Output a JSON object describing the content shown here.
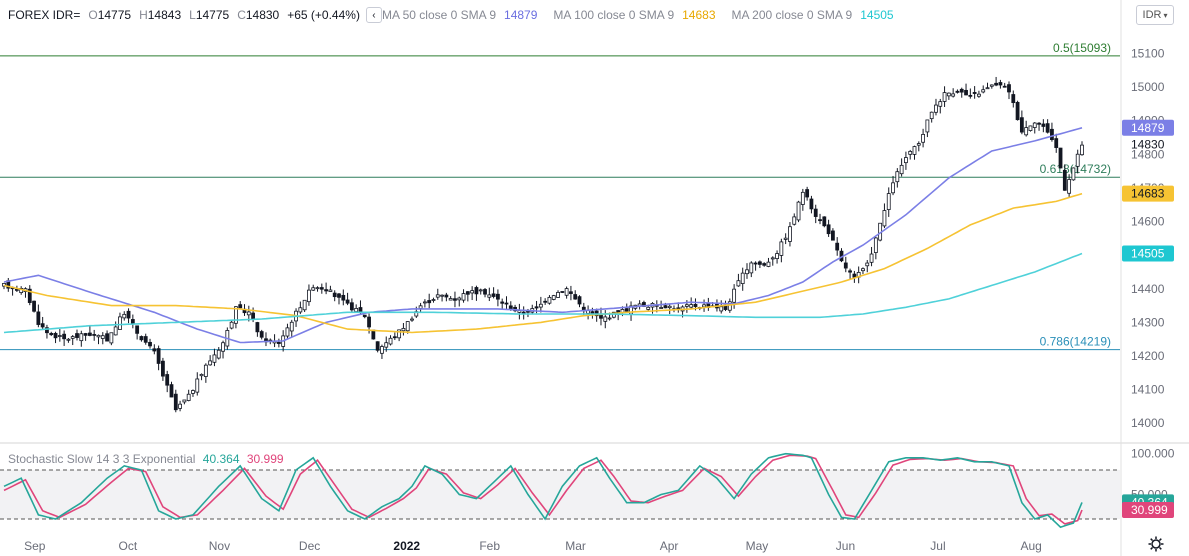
{
  "header": {
    "symbol": "FOREX IDR=",
    "o_label": "O",
    "o": "14775",
    "h_label": "H",
    "h": "14843",
    "l_label": "L",
    "l": "14775",
    "c_label": "C",
    "c": "14830",
    "change": "+65 (+0.44%)",
    "collapse_icon": "chevron-left-icon",
    "ma50_label": "MA 50 close 0 SMA 9",
    "ma50_value": "14879",
    "ma100_label": "MA 100 close 0 SMA 9",
    "ma100_value": "14683",
    "ma200_label": "MA 200 close 0 SMA 9",
    "ma200_value": "14505"
  },
  "symbol_button": {
    "label": "IDR",
    "icon": "dropdown-icon"
  },
  "colors": {
    "up": "#131722",
    "down": "#131722",
    "ma50": "#7b7fe6",
    "ma100": "#f6c333",
    "ma200": "#4fd1d9",
    "fib05": "#2e7d32",
    "fib0618": "#2e7d5b",
    "fib0786": "#2a8fb8",
    "stoch_k": "#26a69a",
    "stoch_d": "#e0457b",
    "grid": "#e6e6e6",
    "axis_text": "#6a6d78"
  },
  "fib_levels": [
    {
      "label": "0.5(15093)",
      "value": 15093
    },
    {
      "label": "0.618(14732)",
      "value": 14732
    },
    {
      "label": "0.786(14219)",
      "value": 14219
    }
  ],
  "price_badges": [
    {
      "label": "14879",
      "value": 14879,
      "color": "#7b7fe6"
    },
    {
      "label": "14830",
      "value": 14830,
      "color": "none"
    },
    {
      "label": "14683",
      "value": 14683,
      "color": "#f6c333"
    },
    {
      "label": "14505",
      "value": 14505,
      "color": "#1ec7d1"
    }
  ],
  "stoch": {
    "title": "Stochastic Slow 14 3 3 Exponential",
    "k_value": "40.364",
    "d_value": "30.999",
    "axis_ticks": [
      "100.000",
      "50.000"
    ],
    "upper_band": 80,
    "lower_band": 20
  },
  "chart_data": {
    "type": "candlestick",
    "y_ticks": [
      15100,
      15000,
      14900,
      14800,
      14700,
      14600,
      14500,
      14400,
      14300,
      14200,
      14100,
      14000
    ],
    "y_range": [
      13950,
      15170
    ],
    "x_ticks": [
      "Sep",
      "Oct",
      "Nov",
      "Dec",
      "2022",
      "Feb",
      "Mar",
      "Apr",
      "May",
      "Jun",
      "Jul",
      "Aug"
    ],
    "x_tick_index": [
      7,
      29,
      50,
      71,
      93,
      113,
      133,
      155,
      175,
      196,
      218,
      239
    ],
    "bars": 252,
    "close_anchors": [
      [
        0,
        14410
      ],
      [
        5,
        14395
      ],
      [
        8,
        14300
      ],
      [
        10,
        14270
      ],
      [
        14,
        14250
      ],
      [
        20,
        14265
      ],
      [
        24,
        14250
      ],
      [
        28,
        14330
      ],
      [
        31,
        14270
      ],
      [
        35,
        14210
      ],
      [
        40,
        14040
      ],
      [
        43,
        14080
      ],
      [
        47,
        14170
      ],
      [
        51,
        14240
      ],
      [
        54,
        14340
      ],
      [
        57,
        14330
      ],
      [
        60,
        14250
      ],
      [
        64,
        14240
      ],
      [
        69,
        14350
      ],
      [
        72,
        14410
      ],
      [
        75,
        14400
      ],
      [
        79,
        14360
      ],
      [
        84,
        14320
      ],
      [
        87,
        14220
      ],
      [
        91,
        14260
      ],
      [
        94,
        14300
      ],
      [
        97,
        14350
      ],
      [
        101,
        14380
      ],
      [
        105,
        14370
      ],
      [
        108,
        14390
      ],
      [
        112,
        14390
      ],
      [
        116,
        14360
      ],
      [
        120,
        14330
      ],
      [
        124,
        14340
      ],
      [
        127,
        14380
      ],
      [
        131,
        14400
      ],
      [
        135,
        14340
      ],
      [
        139,
        14310
      ],
      [
        143,
        14330
      ],
      [
        147,
        14350
      ],
      [
        151,
        14350
      ],
      [
        154,
        14350
      ],
      [
        157,
        14340
      ],
      [
        160,
        14350
      ],
      [
        165,
        14350
      ],
      [
        168,
        14340
      ],
      [
        171,
        14420
      ],
      [
        174,
        14480
      ],
      [
        177,
        14470
      ],
      [
        180,
        14510
      ],
      [
        183,
        14580
      ],
      [
        186,
        14690
      ],
      [
        189,
        14620
      ],
      [
        192,
        14570
      ],
      [
        195,
        14480
      ],
      [
        198,
        14430
      ],
      [
        201,
        14470
      ],
      [
        204,
        14590
      ],
      [
        207,
        14720
      ],
      [
        210,
        14790
      ],
      [
        213,
        14830
      ],
      [
        216,
        14930
      ],
      [
        219,
        14980
      ],
      [
        222,
        14990
      ],
      [
        225,
        14970
      ],
      [
        228,
        14990
      ],
      [
        231,
        15010
      ],
      [
        234,
        14990
      ],
      [
        237,
        14870
      ],
      [
        240,
        14900
      ],
      [
        243,
        14870
      ],
      [
        245,
        14820
      ],
      [
        247,
        14700
      ],
      [
        249,
        14760
      ],
      [
        251,
        14830
      ]
    ],
    "series": [
      {
        "name": "MA 50 close 0 SMA 9",
        "anchors": [
          [
            0,
            14420
          ],
          [
            8,
            14440
          ],
          [
            20,
            14390
          ],
          [
            35,
            14330
          ],
          [
            45,
            14280
          ],
          [
            55,
            14240
          ],
          [
            65,
            14245
          ],
          [
            75,
            14300
          ],
          [
            85,
            14330
          ],
          [
            95,
            14340
          ],
          [
            105,
            14340
          ],
          [
            115,
            14340
          ],
          [
            130,
            14330
          ],
          [
            145,
            14345
          ],
          [
            160,
            14360
          ],
          [
            170,
            14355
          ],
          [
            178,
            14380
          ],
          [
            186,
            14420
          ],
          [
            193,
            14480
          ],
          [
            200,
            14530
          ],
          [
            210,
            14620
          ],
          [
            220,
            14730
          ],
          [
            230,
            14810
          ],
          [
            240,
            14840
          ],
          [
            251,
            14879
          ]
        ]
      },
      {
        "name": "MA 100 close 0 SMA 9",
        "anchors": [
          [
            0,
            14410
          ],
          [
            10,
            14380
          ],
          [
            25,
            14350
          ],
          [
            40,
            14350
          ],
          [
            55,
            14340
          ],
          [
            68,
            14320
          ],
          [
            80,
            14280
          ],
          [
            95,
            14270
          ],
          [
            110,
            14280
          ],
          [
            125,
            14300
          ],
          [
            135,
            14320
          ],
          [
            145,
            14330
          ],
          [
            160,
            14340
          ],
          [
            175,
            14360
          ],
          [
            185,
            14390
          ],
          [
            195,
            14420
          ],
          [
            205,
            14460
          ],
          [
            215,
            14520
          ],
          [
            225,
            14590
          ],
          [
            235,
            14640
          ],
          [
            245,
            14660
          ],
          [
            251,
            14683
          ]
        ]
      },
      {
        "name": "MA 200 close 0 SMA 9",
        "anchors": [
          [
            0,
            14270
          ],
          [
            20,
            14290
          ],
          [
            40,
            14300
          ],
          [
            60,
            14310
          ],
          [
            80,
            14330
          ],
          [
            100,
            14330
          ],
          [
            120,
            14325
          ],
          [
            140,
            14325
          ],
          [
            160,
            14320
          ],
          [
            175,
            14315
          ],
          [
            190,
            14315
          ],
          [
            200,
            14325
          ],
          [
            210,
            14345
          ],
          [
            220,
            14370
          ],
          [
            230,
            14410
          ],
          [
            240,
            14450
          ],
          [
            251,
            14505
          ]
        ]
      }
    ],
    "stoch_k_anchors": [
      [
        0,
        60
      ],
      [
        4,
        70
      ],
      [
        8,
        25
      ],
      [
        12,
        20
      ],
      [
        18,
        40
      ],
      [
        24,
        70
      ],
      [
        28,
        85
      ],
      [
        32,
        80
      ],
      [
        36,
        30
      ],
      [
        40,
        20
      ],
      [
        44,
        25
      ],
      [
        50,
        60
      ],
      [
        55,
        85
      ],
      [
        60,
        45
      ],
      [
        64,
        30
      ],
      [
        68,
        80
      ],
      [
        72,
        95
      ],
      [
        76,
        60
      ],
      [
        80,
        30
      ],
      [
        84,
        20
      ],
      [
        88,
        35
      ],
      [
        92,
        45
      ],
      [
        95,
        60
      ],
      [
        98,
        85
      ],
      [
        102,
        75
      ],
      [
        106,
        50
      ],
      [
        110,
        45
      ],
      [
        114,
        65
      ],
      [
        118,
        85
      ],
      [
        122,
        50
      ],
      [
        126,
        20
      ],
      [
        130,
        60
      ],
      [
        134,
        85
      ],
      [
        138,
        95
      ],
      [
        141,
        70
      ],
      [
        145,
        40
      ],
      [
        149,
        40
      ],
      [
        153,
        50
      ],
      [
        157,
        55
      ],
      [
        162,
        85
      ],
      [
        166,
        70
      ],
      [
        170,
        45
      ],
      [
        174,
        75
      ],
      [
        178,
        95
      ],
      [
        182,
        100
      ],
      [
        186,
        98
      ],
      [
        188,
        95
      ],
      [
        192,
        50
      ],
      [
        195,
        22
      ],
      [
        198,
        20
      ],
      [
        202,
        55
      ],
      [
        206,
        90
      ],
      [
        210,
        95
      ],
      [
        214,
        95
      ],
      [
        218,
        92
      ],
      [
        222,
        95
      ],
      [
        226,
        90
      ],
      [
        230,
        90
      ],
      [
        234,
        85
      ],
      [
        237,
        40
      ],
      [
        240,
        20
      ],
      [
        243,
        25
      ],
      [
        246,
        10
      ],
      [
        249,
        15
      ],
      [
        251,
        40.364
      ]
    ],
    "stoch_d_anchors": [
      [
        0,
        55
      ],
      [
        5,
        68
      ],
      [
        9,
        30
      ],
      [
        13,
        22
      ],
      [
        19,
        38
      ],
      [
        25,
        65
      ],
      [
        29,
        82
      ],
      [
        33,
        78
      ],
      [
        37,
        35
      ],
      [
        41,
        22
      ],
      [
        45,
        25
      ],
      [
        51,
        55
      ],
      [
        56,
        82
      ],
      [
        61,
        48
      ],
      [
        65,
        32
      ],
      [
        69,
        75
      ],
      [
        73,
        92
      ],
      [
        77,
        62
      ],
      [
        81,
        32
      ],
      [
        85,
        22
      ],
      [
        89,
        33
      ],
      [
        93,
        45
      ],
      [
        96,
        58
      ],
      [
        99,
        82
      ],
      [
        103,
        75
      ],
      [
        107,
        52
      ],
      [
        111,
        45
      ],
      [
        115,
        62
      ],
      [
        119,
        82
      ],
      [
        123,
        52
      ],
      [
        127,
        25
      ],
      [
        131,
        55
      ],
      [
        135,
        82
      ],
      [
        139,
        92
      ],
      [
        142,
        72
      ],
      [
        146,
        42
      ],
      [
        150,
        40
      ],
      [
        154,
        48
      ],
      [
        158,
        55
      ],
      [
        163,
        82
      ],
      [
        167,
        72
      ],
      [
        171,
        48
      ],
      [
        175,
        72
      ],
      [
        179,
        92
      ],
      [
        183,
        98
      ],
      [
        187,
        97
      ],
      [
        189,
        94
      ],
      [
        193,
        55
      ],
      [
        196,
        25
      ],
      [
        199,
        22
      ],
      [
        203,
        52
      ],
      [
        207,
        86
      ],
      [
        211,
        93
      ],
      [
        215,
        94
      ],
      [
        219,
        92
      ],
      [
        223,
        94
      ],
      [
        227,
        90
      ],
      [
        231,
        89
      ],
      [
        235,
        85
      ],
      [
        238,
        45
      ],
      [
        241,
        24
      ],
      [
        244,
        26
      ],
      [
        247,
        14
      ],
      [
        250,
        18
      ],
      [
        251,
        30.999
      ]
    ]
  }
}
